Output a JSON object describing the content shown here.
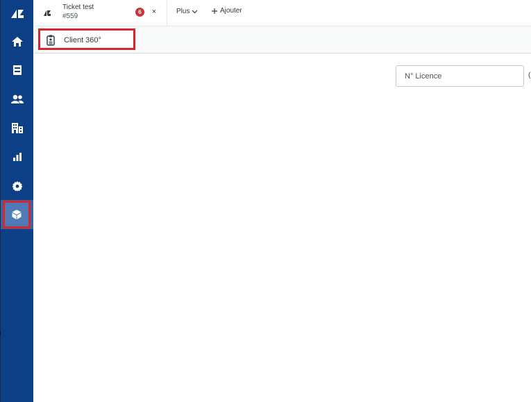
{
  "sidebar": {
    "items": [
      {
        "icon": "zendesk-logo-icon"
      },
      {
        "icon": "home-icon"
      },
      {
        "icon": "views-icon"
      },
      {
        "icon": "users-icon"
      },
      {
        "icon": "organizations-icon"
      },
      {
        "icon": "reporting-icon"
      },
      {
        "icon": "admin-gear-icon"
      },
      {
        "icon": "apps-cube-icon",
        "active": true
      }
    ]
  },
  "tabs": {
    "ticket": {
      "title": "Ticket test",
      "number": "#559",
      "badge_count": "6",
      "close_label": "×"
    },
    "more_label": "Plus",
    "add_label": "Ajouter"
  },
  "subheader": {
    "client_tab_label": "Client 360°"
  },
  "main": {
    "license_placeholder": "N° Licence",
    "edge_glyph": "("
  },
  "colors": {
    "sidebar_bg": "#0d3f86",
    "highlight_red": "#d8262e",
    "badge_red": "#cc3340"
  }
}
